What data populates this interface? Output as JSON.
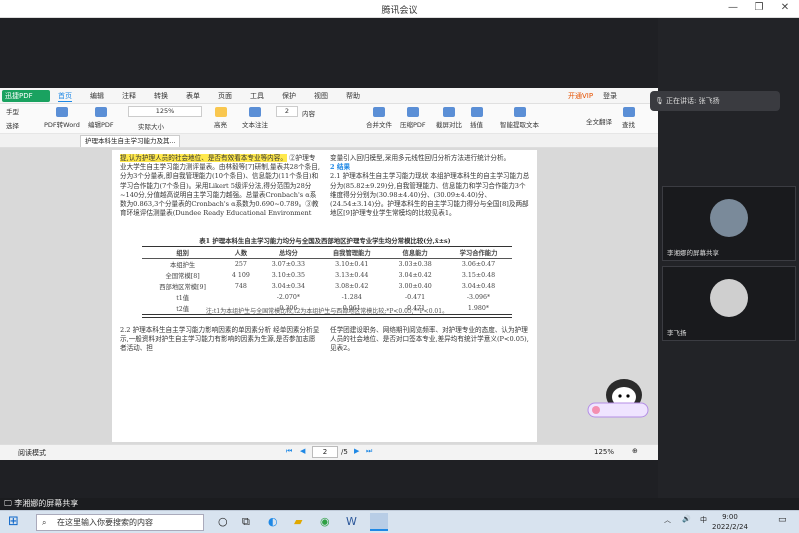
{
  "window": {
    "title": "腾讯会议"
  },
  "pdf": {
    "brand": "迅捷PDF",
    "menus": [
      "首页",
      "编辑",
      "注释",
      "转换",
      "表单",
      "页面",
      "工具",
      "保护",
      "视图",
      "帮助"
    ],
    "tools": {
      "hand": "手型",
      "select": "选择",
      "pdf_to_word": "PDF转Word",
      "edit_pdf": "编辑PDF",
      "zoom_value": "125%",
      "actual_size": "实际大小",
      "highlight": "高亮",
      "text_note": "文本注注",
      "page_value": "2",
      "insert_page": "内容",
      "merge": "合并文件",
      "compress": "压缩PDF",
      "contrast": "截屏对比",
      "insert": "插值",
      "translate": "智能提取文本",
      "translate_full": "全文翻译",
      "search": "查找",
      "login": "登录",
      "vip": "开通VIP"
    },
    "tab_label": "护理本科生自主学习能力及其...",
    "page_count": "/5",
    "zoom_status": "125%",
    "status_left": "阅读模式",
    "page": {
      "left_col_p1": "提,认为护理人员的社会地位、是否有效看本专业等内容。",
      "left_col_p2": "②护理专业大学生自主学习能力测评量表。由林毅等[7]研制,量表共28个条目,分为3个分量表,即自我管理能力(10个条目)、信息能力(11个条目)和学习合作能力(7个条目)。采用Likert 5级评分法,得分范围为28分~140分,分值越高说明自主学习能力越强。总量表Cronbach's α系数为0.863,3个分量表的Cronbach's α系数为0.690~0.789。③教育环境评估测量表(Dundee Ready Educational Environment",
      "right_col_p1": "变量引入回归模型,采用多元线性回归分析方法进行统计分析。",
      "right_col_head": "2 结果",
      "right_col_p2": "2.1 护理本科生自主学习能力现状 本组护理本科生的自主学习能力总分为(85.82±9.29)分,自我管理能力、信息能力和学习合作能力3个维度得分分别为(30.98±4.40)分、(30.09±4.40)分、(24.54±3.14)分。护理本科生的自主学习能力得分与全国[8]及两部地区[9]护理专业学生常模均的比较见表1。",
      "table_title": "表1 护理本科生自主学习能力均分与全国及西部地区护理专业学生均分常模比较(分,x̄±s)",
      "table_headers": [
        "组别",
        "人数",
        "总均分",
        "自我管理能力",
        "信息能力",
        "学习合作能力"
      ],
      "table_rows": [
        [
          "本组护生",
          "257",
          "3.07±0.33",
          "3.10±0.41",
          "3.03±0.38",
          "3.06±0.47"
        ],
        [
          "全国常模[8]",
          "4 109",
          "3.10±0.35",
          "3.13±0.44",
          "3.04±0.42",
          "3.15±0.48"
        ],
        [
          "西部地区常模[9]",
          "748",
          "3.04±0.34",
          "3.08±0.42",
          "3.00±0.40",
          "3.04±0.48"
        ],
        [
          "t1值",
          "",
          "-2.070*",
          "-1.284",
          "-0.471",
          "-3.096*"
        ],
        [
          "t2值",
          "",
          "0.306",
          "0.961",
          "-0.471",
          "1.980*"
        ]
      ],
      "table_note": "注:t1为本组护生与全国常模比较,t2为本组护生与西部地区常模比较;*P<0.05,**P<0.01。",
      "bottom_left": "2.2 护理本科生自主学习能力影响因素的单因素分析 经单因素分析显示,一般资料对护生自主学习能力有影响的因素为生源,是否参加志愿者活动、担",
      "bottom_right": "任学团建设职务、网络期刊阅览频率、对护理专业的态度、认为护理人员的社会地位、是否对口签本专业,差异均有统计学意义(P<0.05),见表2。"
    }
  },
  "sidebar": {
    "speaking_label": "正在讲话: 张飞扬",
    "participants": [
      {
        "name": "李湘娜的屏幕共享"
      },
      {
        "name": "李飞扬"
      }
    ]
  },
  "meeting": {
    "sharer_label": "李湘娜的屏幕共享"
  },
  "taskbar": {
    "search_placeholder": "在这里输入你要搜索的内容",
    "time": "9:00",
    "date": "2022/2/24",
    "ime": "中"
  }
}
